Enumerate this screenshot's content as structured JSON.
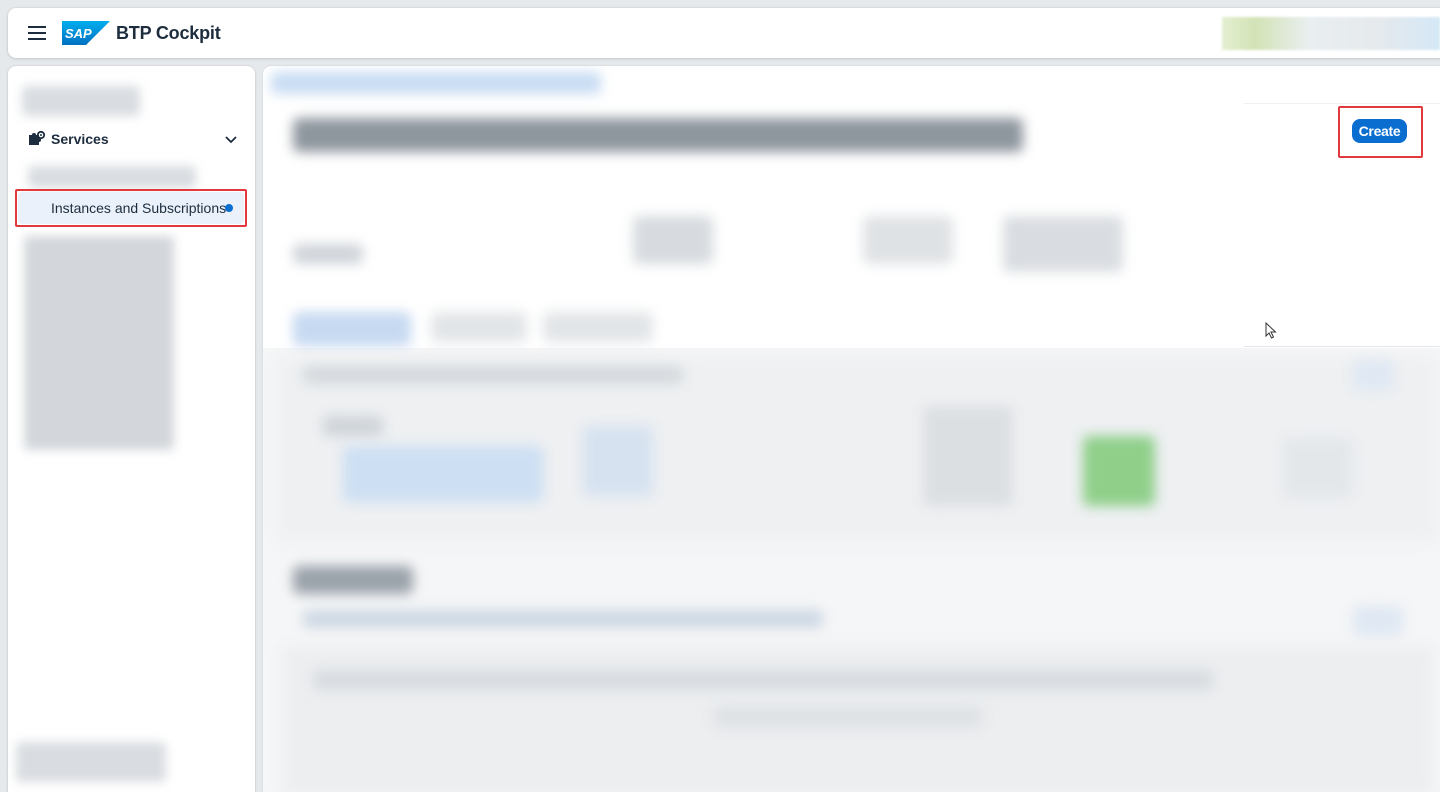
{
  "shell": {
    "menu_icon": "hamburger-menu-icon",
    "logo_icon": "sap-logo-icon",
    "title": "BTP Cockpit"
  },
  "sidenav": {
    "group": {
      "icon": "services-puzzle-icon",
      "label": "Services",
      "expand_icon": "chevron-down-icon"
    },
    "selected_item": {
      "label": "Instances and Subscriptions",
      "indicator_color": "#0a6ed1"
    }
  },
  "main": {
    "create_button": "Create"
  },
  "colors": {
    "accent": "#0a6ed1",
    "highlight": "#e0393e"
  }
}
